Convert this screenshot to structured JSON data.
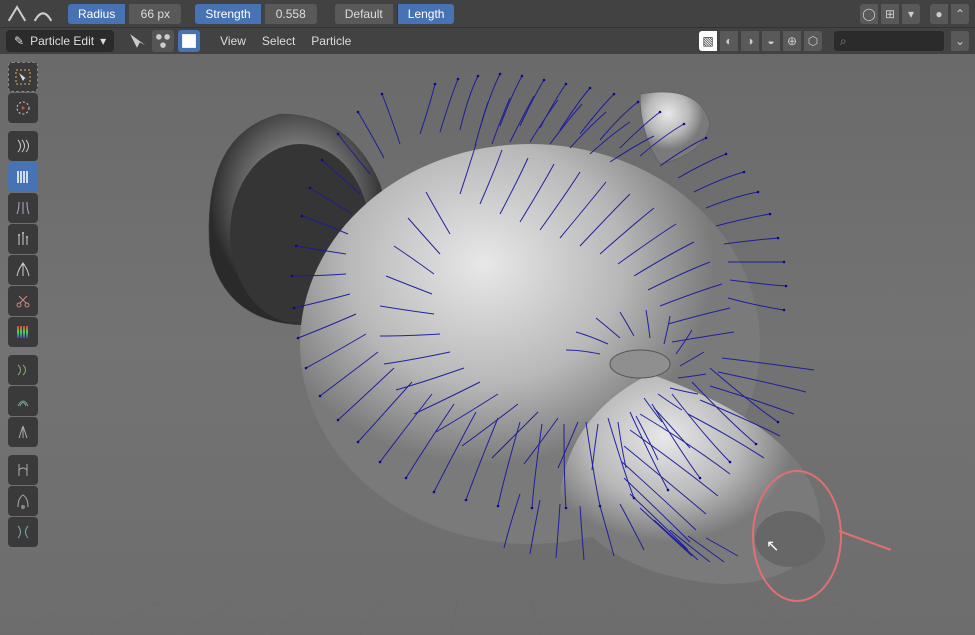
{
  "header": {
    "radius_label": "Radius",
    "radius_value": "66 px",
    "strength_label": "Strength",
    "strength_value": "0.558",
    "default_label": "Default",
    "length_label": "Length"
  },
  "header2": {
    "mode": "Particle Edit",
    "menu_view": "View",
    "menu_select": "Select",
    "menu_particle": "Particle"
  },
  "tools": {
    "select": "select-box",
    "cursor": "cursor-3d",
    "comb": "comb",
    "smooth": "smooth",
    "add": "add",
    "length": "length",
    "puff": "puff",
    "cut": "cut",
    "weight": "weight",
    "t1": "tool-a",
    "t2": "tool-b",
    "t3": "tool-c",
    "t4": "tool-d",
    "t5": "tool-e",
    "t6": "tool-f",
    "t7": "tool-g"
  },
  "colors": {
    "accent": "#4772b3",
    "brush": "#e36f70",
    "hair": "#1a1a9e"
  }
}
